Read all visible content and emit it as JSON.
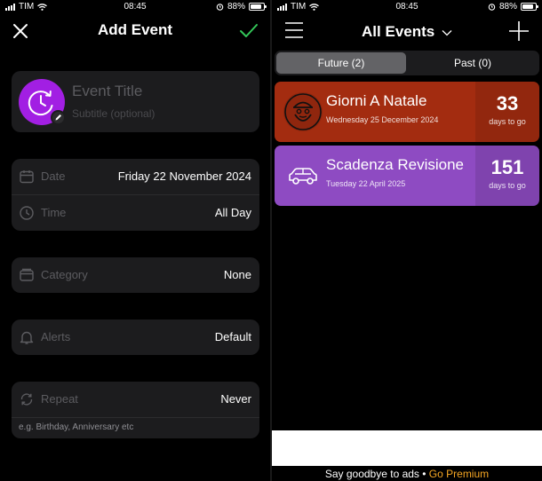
{
  "left_screen": {
    "status": {
      "carrier": "TIM",
      "time": "08:45",
      "battery": "88%",
      "battery_level": 0.88
    },
    "header": {
      "title": "Add Event",
      "close_icon": "close-icon",
      "confirm_icon": "checkmark-icon"
    },
    "title_card": {
      "title_placeholder": "Event Title",
      "subtitle_placeholder": "Subtitle (optional)",
      "avatar_icon": "clock-icon",
      "avatar_color": "#a21fe3"
    },
    "date_time": {
      "date_label": "Date",
      "date_value": "Friday 22 November 2024",
      "time_label": "Time",
      "time_value": "All Day"
    },
    "category": {
      "label": "Category",
      "value": "None"
    },
    "alerts": {
      "label": "Alerts",
      "value": "Default"
    },
    "repeat": {
      "label": "Repeat",
      "value": "Never",
      "hint": "e.g. Birthday, Anniversary etc"
    }
  },
  "right_screen": {
    "status": {
      "carrier": "TIM",
      "time": "08:45",
      "battery": "88%",
      "battery_level": 0.88
    },
    "header": {
      "title": "All Events",
      "menu_icon": "hamburger-menu-icon",
      "add_icon": "plus-icon"
    },
    "segments": [
      {
        "label": "Future (2)",
        "active": true
      },
      {
        "label": "Past (0)",
        "active": false
      }
    ],
    "events": [
      {
        "title": "Giorni A Natale",
        "date": "Wednesday 25 December 2024",
        "count": "33",
        "unit": "days to go",
        "color": "#a32c10",
        "icon": "santa-icon"
      },
      {
        "title": "Scadenza Revisione",
        "date": "Tuesday 22 April 2025",
        "count": "151",
        "unit": "days to go",
        "color": "#8e4bc2",
        "icon": "car-icon"
      }
    ],
    "ad": {
      "text": "Say goodbye to ads • ",
      "link": "Go Premium",
      "link_color": "#f5a623"
    }
  }
}
